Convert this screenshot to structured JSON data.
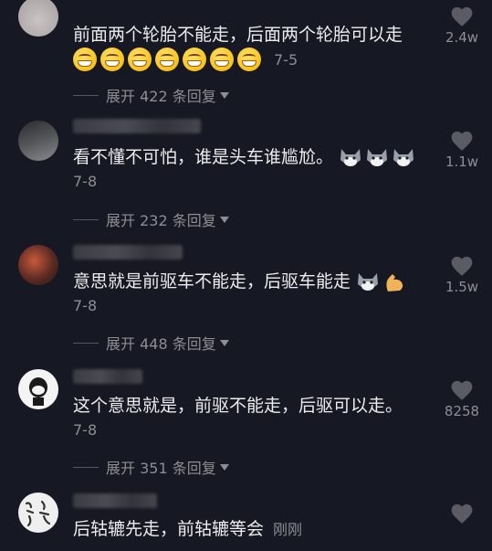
{
  "comments": [
    {
      "text": "前面两个轮胎不能走，后面两个轮胎可以走",
      "emoji_count": 7,
      "date": "7-5",
      "reply_label": "展开 422 条回复",
      "likes": "2.4w"
    },
    {
      "text": "看不懂不可怕，谁是头车谁尴尬。",
      "date": "7-8",
      "reply_label": "展开 232 条回复",
      "likes": "1.1w"
    },
    {
      "text": "意思就是前驱车不能走，后驱车能走",
      "date": "7-8",
      "reply_label": "展开 448 条回复",
      "likes": "1.5w"
    },
    {
      "text": "这个意思就是，前驱不能走，后驱可以走。",
      "date": "7-8",
      "reply_label": "展开 351 条回复",
      "likes": "8258"
    },
    {
      "text": "后轱辘先走，前轱辘等会",
      "date": "刚刚",
      "likes": ""
    }
  ],
  "colors": {
    "background": "#161823",
    "text": "#ececee",
    "muted": "#8d8e94"
  },
  "icons": {
    "like": "heart-icon",
    "emoji": "grin-emoji",
    "husky": "husky-emoji",
    "muscle": "flexed-biceps-emoji",
    "expand": "caret-down-icon"
  }
}
